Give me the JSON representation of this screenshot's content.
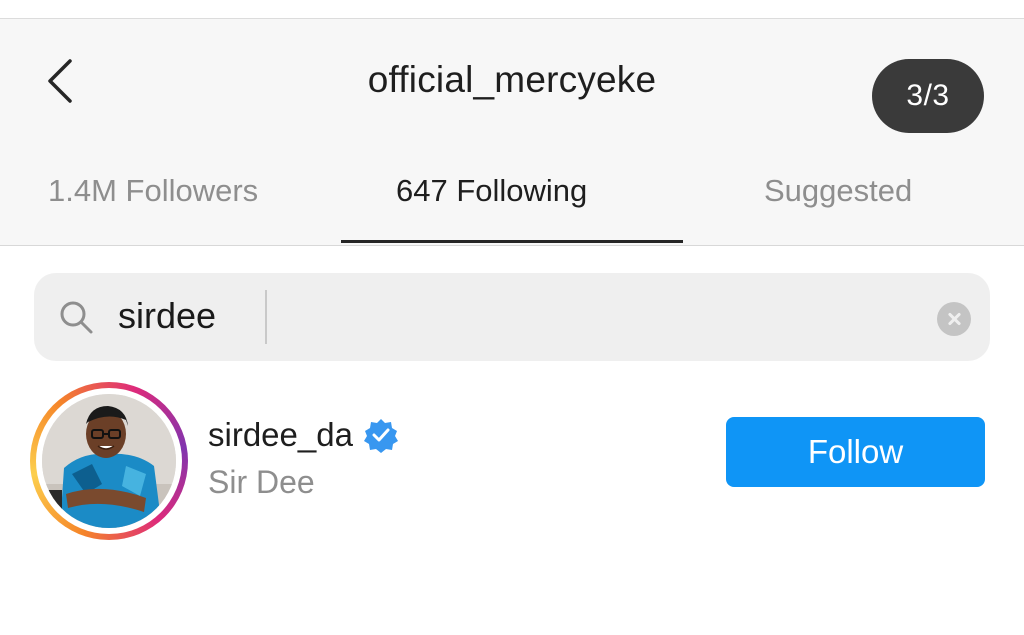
{
  "header": {
    "title": "official_mercyeke",
    "page_counter": "3/3",
    "back_icon": "chevron-left-icon"
  },
  "tabs": [
    {
      "label": "1.4M Followers",
      "active": false
    },
    {
      "label": "647 Following",
      "active": true
    },
    {
      "label": "Suggested",
      "active": false
    }
  ],
  "search": {
    "value": "sirdee",
    "icon": "search-icon",
    "clear_icon": "clear-icon"
  },
  "results": [
    {
      "username": "sirdee_da",
      "full_name": "Sir Dee",
      "verified": true,
      "button_label": "Follow"
    }
  ],
  "colors": {
    "accent": "#0f95f6",
    "header_bg": "#f7f7f7",
    "counter_bg": "#3a3a3a",
    "verified": "#3897f0"
  }
}
